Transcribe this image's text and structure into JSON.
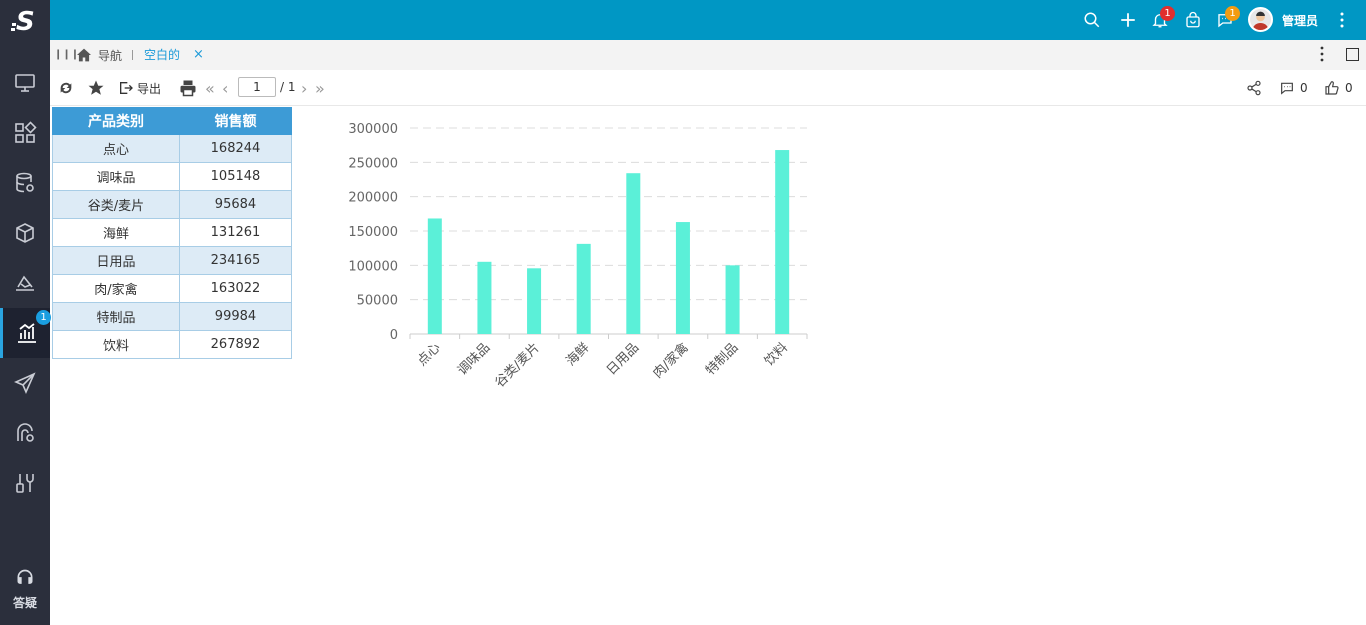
{
  "app": {
    "logo_letter": "S"
  },
  "sidebar": {
    "items": [
      {
        "icon": "monitor-icon"
      },
      {
        "icon": "grid-icon"
      },
      {
        "icon": "database-icon"
      },
      {
        "icon": "cube-icon"
      },
      {
        "icon": "layers-icon"
      },
      {
        "icon": "chart-icon",
        "badge": "1",
        "active": true
      },
      {
        "icon": "send-icon"
      },
      {
        "icon": "process-icon"
      },
      {
        "icon": "tools-icon"
      }
    ],
    "help_label": "答疑"
  },
  "header": {
    "notifications_badge": "1",
    "messages_badge": "1",
    "user_name": "管理员",
    "colors": {
      "bar": "#0097c4",
      "notify_badge": "#e02e2e",
      "message_badge": "#f39c12"
    }
  },
  "tabs": {
    "nav_label": "导航",
    "active_label": "空白的",
    "close_glyph": "×"
  },
  "toolbar": {
    "export_label": "导出",
    "page_current": "1",
    "page_total": "/ 1",
    "comments_count": "0",
    "likes_count": "0"
  },
  "table": {
    "headers": [
      "产品类别",
      "销售额"
    ],
    "rows": [
      [
        "点心",
        "168244"
      ],
      [
        "调味品",
        "105148"
      ],
      [
        "谷类/麦片",
        "95684"
      ],
      [
        "海鲜",
        "131261"
      ],
      [
        "日用品",
        "234165"
      ],
      [
        "肉/家禽",
        "163022"
      ],
      [
        "特制品",
        "99984"
      ],
      [
        "饮料",
        "267892"
      ]
    ]
  },
  "chart_data": {
    "type": "bar",
    "categories": [
      "点心",
      "调味品",
      "谷类/麦片",
      "海鲜",
      "日用品",
      "肉/家禽",
      "特制品",
      "饮料"
    ],
    "values": [
      168244,
      105148,
      95684,
      131261,
      234165,
      163022,
      99984,
      267892
    ],
    "ylim": [
      0,
      300000
    ],
    "yticks": [
      "0",
      "50000",
      "100000",
      "150000",
      "200000",
      "250000",
      "300000"
    ],
    "grid": true,
    "bar_color": "#5bf0d8"
  }
}
